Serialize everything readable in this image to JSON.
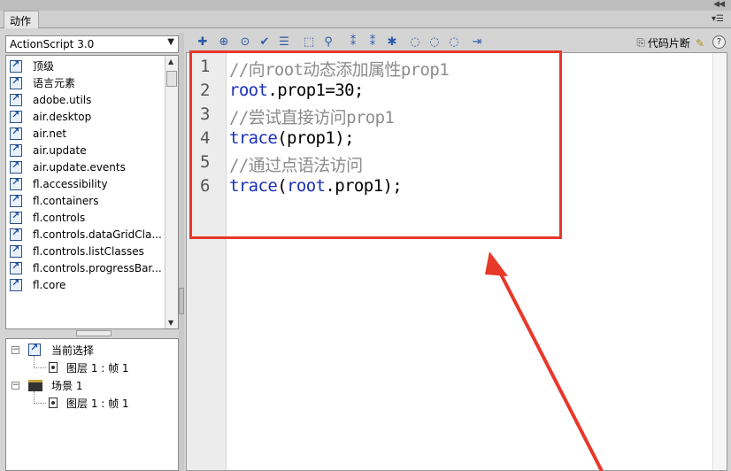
{
  "panel": {
    "title": "动作"
  },
  "left": {
    "combo_value": "ActionScript 3.0",
    "library_items": [
      {
        "label": "顶级"
      },
      {
        "label": "语言元素"
      },
      {
        "label": "adobe.utils"
      },
      {
        "label": "air.desktop"
      },
      {
        "label": "air.net"
      },
      {
        "label": "air.update"
      },
      {
        "label": "air.update.events"
      },
      {
        "label": "fl.accessibility"
      },
      {
        "label": "fl.containers"
      },
      {
        "label": "fl.controls"
      },
      {
        "label": "fl.controls.dataGridCla..."
      },
      {
        "label": "fl.controls.listClasses"
      },
      {
        "label": "fl.controls.progressBar..."
      },
      {
        "label": "fl.core"
      }
    ],
    "tree": {
      "current_selection": "当前选择",
      "current_frame": "图层 1 : 帧 1",
      "scene": "场景 1",
      "scene_frame": "图层 1 : 帧 1"
    }
  },
  "toolbar": {
    "icons": [
      "add-script-item-icon",
      "find-icon",
      "target-path-icon",
      "check-syntax-icon",
      "auto-format-icon",
      "code-hint-icon",
      "debug-options-icon",
      "collapse-braces-icon",
      "collapse-selection-icon",
      "expand-all-icon",
      "apply-block-comment-icon",
      "apply-line-comment-icon",
      "remove-comment-icon",
      "show-hide-toolbox-icon"
    ],
    "snippet_label": "代码片断"
  },
  "editor": {
    "lines": [
      {
        "no": "1",
        "parts": [
          {
            "t": "//向root动态添加属性prop1",
            "c": "cmt"
          }
        ]
      },
      {
        "no": "2",
        "parts": [
          {
            "t": "root",
            "c": "kw"
          },
          {
            "t": ".prop1=30;",
            "c": "txt"
          }
        ]
      },
      {
        "no": "3",
        "parts": [
          {
            "t": "//尝试直接访问prop1",
            "c": "cmt"
          }
        ]
      },
      {
        "no": "4",
        "parts": [
          {
            "t": "trace",
            "c": "kw"
          },
          {
            "t": "(prop1);",
            "c": "txt"
          }
        ]
      },
      {
        "no": "5",
        "parts": [
          {
            "t": "//通过点语法访问",
            "c": "cmt"
          }
        ]
      },
      {
        "no": "6",
        "parts": [
          {
            "t": "trace",
            "c": "kw"
          },
          {
            "t": "(",
            "c": "txt"
          },
          {
            "t": "root",
            "c": "kw"
          },
          {
            "t": ".prop1);",
            "c": "txt"
          }
        ]
      }
    ]
  },
  "colors": {
    "annotation": "#e8382a",
    "keyword": "#1b2fb8",
    "comment": "#8c8c8c"
  }
}
